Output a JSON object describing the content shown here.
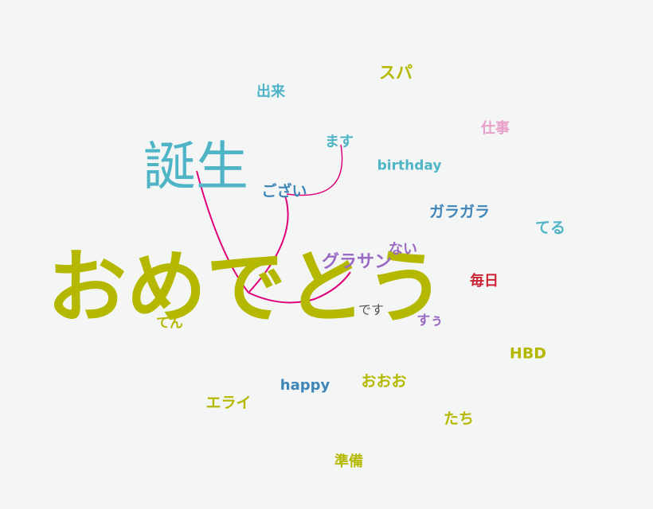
{
  "words": [
    {
      "id": "omedetou",
      "text": "おめでとう",
      "color": "#b5b800"
    },
    {
      "id": "tanjou",
      "text": "誕生",
      "color": "#4fb5c6"
    },
    {
      "id": "gozai",
      "text": "ござい",
      "color": "#3f86b8"
    },
    {
      "id": "masu",
      "text": "ます",
      "color": "#4fb5c6"
    },
    {
      "id": "desu",
      "text": "です",
      "color": "#555555"
    },
    {
      "id": "gurasan",
      "text": "グラサン",
      "color": "#9b6bc4"
    },
    {
      "id": "nai",
      "text": "ない",
      "color": "#9b6bc4"
    },
    {
      "id": "dekiru",
      "text": "出来",
      "color": "#4fb5c6"
    },
    {
      "id": "supa",
      "text": "スパ",
      "color": "#b5b800"
    },
    {
      "id": "shigoto",
      "text": "仕事",
      "color": "#e8a0c8"
    },
    {
      "id": "birthday",
      "text": "birthday",
      "color": "#4fb5c6"
    },
    {
      "id": "garagara",
      "text": "ガラガラ",
      "color": "#3f86b8"
    },
    {
      "id": "teru",
      "text": "てる",
      "color": "#4fb5c6"
    },
    {
      "id": "mainichi",
      "text": "毎日",
      "color": "#cc2233"
    },
    {
      "id": "suu",
      "text": "すぅ",
      "color": "#9b6bc4"
    },
    {
      "id": "ten",
      "text": "てん",
      "color": "#b5b800"
    },
    {
      "id": "hbd",
      "text": "HBD",
      "color": "#b5b800"
    },
    {
      "id": "happy",
      "text": "happy",
      "color": "#3f86b8"
    },
    {
      "id": "ooo",
      "text": "おおお",
      "color": "#b5b800"
    },
    {
      "id": "erai",
      "text": "エライ",
      "color": "#b5b800"
    },
    {
      "id": "tachi",
      "text": "たち",
      "color": "#b5b800"
    },
    {
      "id": "junbi",
      "text": "準備",
      "color": "#b5b800"
    }
  ],
  "links": [
    {
      "from": "tanjou",
      "to": "omedetou",
      "color": "#e0007a"
    },
    {
      "from": "gozai",
      "to": "omedetou",
      "color": "#e0007a"
    },
    {
      "from": "masu",
      "to": "gozai",
      "color": "#e0007a"
    },
    {
      "from": "omedetou",
      "to": "gurasan",
      "color": "#e0007a"
    }
  ]
}
